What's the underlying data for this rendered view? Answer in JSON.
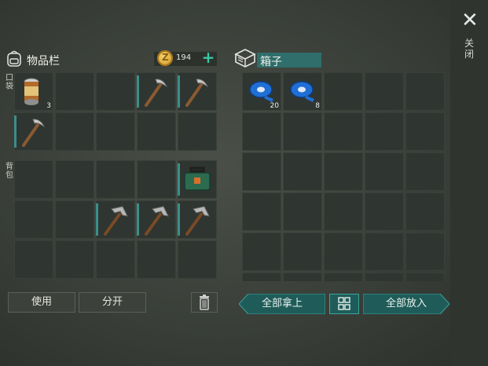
{
  "inventory": {
    "title": "物品栏",
    "coins": "194",
    "plus": "+",
    "pocket_label": "口袋",
    "backpack_label": "背包",
    "pocket_slots": [
      {
        "item": "canned-food",
        "qty": "3"
      },
      {
        "item": ""
      },
      {
        "item": ""
      },
      {
        "item": "pickaxe",
        "qty": ""
      },
      {
        "item": "pickaxe",
        "qty": ""
      },
      {
        "item": "pickaxe",
        "qty": ""
      },
      {
        "item": ""
      },
      {
        "item": ""
      },
      {
        "item": ""
      },
      {
        "item": ""
      }
    ],
    "backpack_slots": [
      {
        "item": ""
      },
      {
        "item": ""
      },
      {
        "item": ""
      },
      {
        "item": ""
      },
      {
        "item": "toolbox",
        "qty": ""
      },
      {
        "item": ""
      },
      {
        "item": ""
      },
      {
        "item": "hammer",
        "qty": ""
      },
      {
        "item": "hammer",
        "qty": ""
      },
      {
        "item": "hammer",
        "qty": ""
      },
      {
        "item": ""
      },
      {
        "item": ""
      },
      {
        "item": ""
      },
      {
        "item": ""
      },
      {
        "item": ""
      }
    ],
    "use_label": "使用",
    "split_label": "分开"
  },
  "box": {
    "title": "箱子",
    "slots": [
      {
        "item": "tape",
        "qty": "20"
      },
      {
        "item": "tape",
        "qty": "8"
      },
      {
        "item": ""
      },
      {
        "item": ""
      },
      {
        "item": ""
      },
      {
        "item": ""
      },
      {
        "item": ""
      },
      {
        "item": ""
      },
      {
        "item": ""
      },
      {
        "item": ""
      },
      {
        "item": ""
      },
      {
        "item": ""
      },
      {
        "item": ""
      },
      {
        "item": ""
      },
      {
        "item": ""
      },
      {
        "item": ""
      },
      {
        "item": ""
      },
      {
        "item": ""
      },
      {
        "item": ""
      },
      {
        "item": ""
      },
      {
        "item": ""
      },
      {
        "item": ""
      },
      {
        "item": ""
      },
      {
        "item": ""
      },
      {
        "item": ""
      },
      {
        "item": ""
      },
      {
        "item": ""
      },
      {
        "item": ""
      },
      {
        "item": ""
      },
      {
        "item": ""
      }
    ],
    "take_all_label": "全部拿上",
    "put_all_label": "全部放入"
  },
  "close": {
    "label": "关闭"
  },
  "icons": {
    "backpack": "backpack-icon",
    "coin": "coin-icon",
    "box": "box-icon",
    "trash": "trash-icon",
    "sort": "sort-icon",
    "close": "close-icon"
  },
  "colors": {
    "accent": "#2f8f88",
    "coin": "#e0a82a",
    "plus": "#3bc5a3"
  }
}
